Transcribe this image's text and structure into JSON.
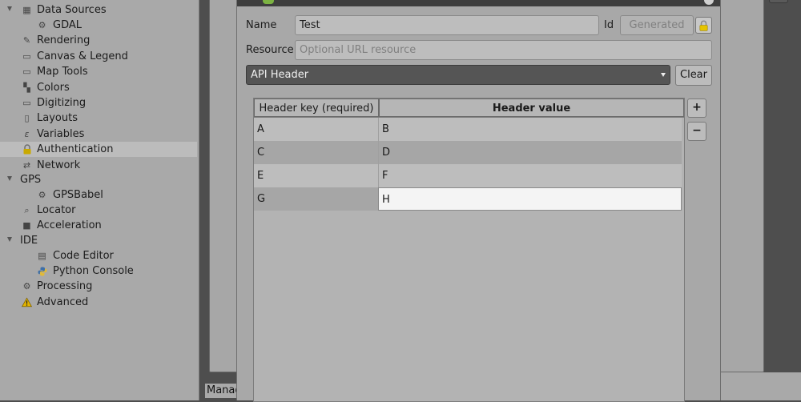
{
  "sidebar": {
    "items": [
      {
        "label": "Data Sources",
        "icon": "data-sources-icon"
      },
      {
        "label": "GDAL",
        "icon": "gdal-icon"
      },
      {
        "label": "Rendering",
        "icon": "rendering-icon"
      },
      {
        "label": "Canvas & Legend",
        "icon": "canvas-legend-icon"
      },
      {
        "label": "Map Tools",
        "icon": "map-tools-icon"
      },
      {
        "label": "Colors",
        "icon": "colors-icon"
      },
      {
        "label": "Digitizing",
        "icon": "digitizing-icon"
      },
      {
        "label": "Layouts",
        "icon": "layouts-icon"
      },
      {
        "label": "Variables",
        "icon": "variables-icon"
      },
      {
        "label": "Authentication",
        "icon": "lock-icon",
        "selected": true
      },
      {
        "label": "Network",
        "icon": "network-icon"
      },
      {
        "label": "GPS"
      },
      {
        "label": "GPSBabel",
        "icon": "gpsbabel-icon"
      },
      {
        "label": "Locator",
        "icon": "locator-icon"
      },
      {
        "label": "Acceleration",
        "icon": "acceleration-icon"
      },
      {
        "label": "IDE"
      },
      {
        "label": "Code Editor",
        "icon": "code-editor-icon"
      },
      {
        "label": "Python Console",
        "icon": "python-icon"
      },
      {
        "label": "Processing",
        "icon": "processing-icon"
      },
      {
        "label": "Advanced",
        "icon": "warning-icon"
      }
    ]
  },
  "background": {
    "manage_label": "Manag"
  },
  "dialog": {
    "name_label": "Name",
    "name_value": "Test",
    "id_label": "Id",
    "id_placeholder": "Generated",
    "resource_label": "Resource",
    "resource_placeholder": "Optional URL resource",
    "auth_method": "API Header",
    "clear_label": "Clear",
    "add_row_label": "+",
    "remove_row_label": "−",
    "table": {
      "columns": [
        "Header key (required)",
        "Header value"
      ],
      "rows": [
        {
          "key": "A",
          "value": "B"
        },
        {
          "key": "C",
          "value": "D"
        },
        {
          "key": "E",
          "value": "F"
        },
        {
          "key": "G",
          "value": "H"
        }
      ]
    }
  },
  "colors": {
    "lock_yellow": "#e6c400",
    "python_blue": "#3e6fa8",
    "python_yellow": "#e0b93a"
  }
}
